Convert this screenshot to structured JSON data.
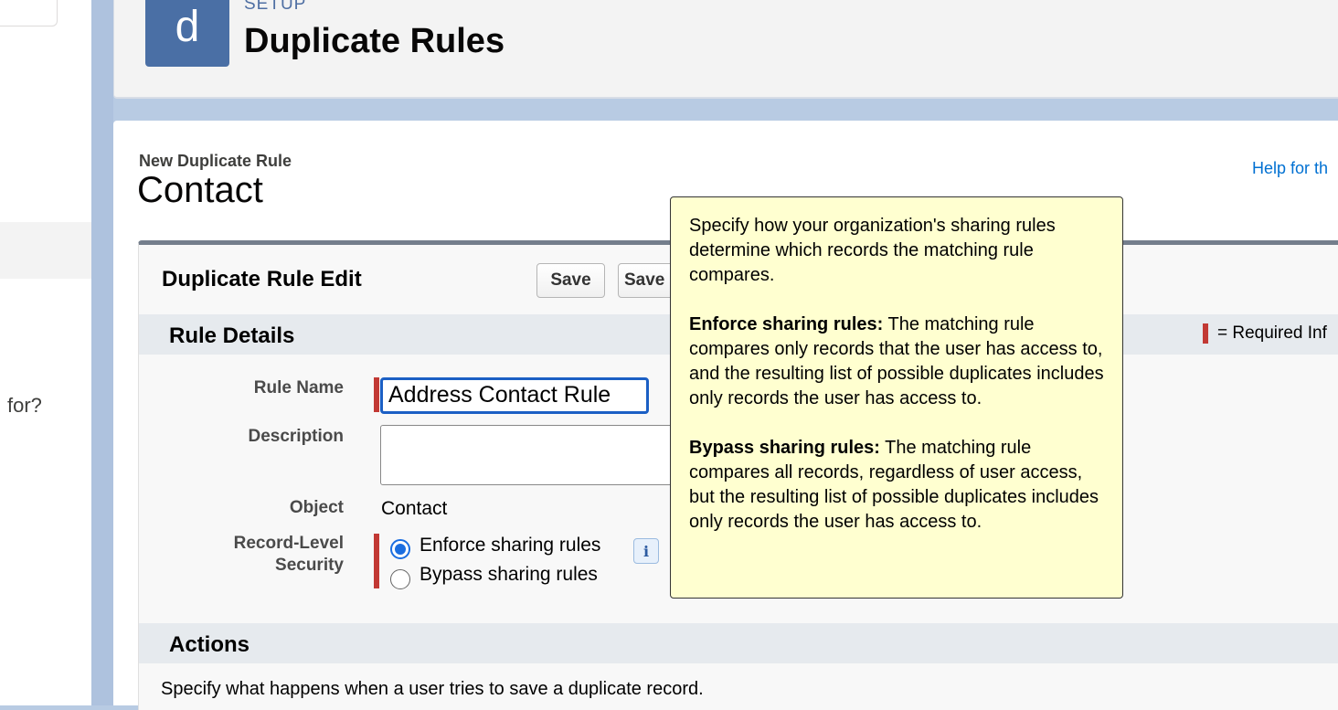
{
  "sidebar": {
    "partial_text": "for?"
  },
  "header": {
    "icon_letter": "d",
    "setup_label": "SETUP",
    "page_title": "Duplicate Rules"
  },
  "content": {
    "sub_title": "New Duplicate Rule",
    "object_title": "Contact",
    "help_link": "Help for th"
  },
  "edit": {
    "title": "Duplicate Rule Edit",
    "save_label": "Save",
    "save_new_label": "Save"
  },
  "rule_details": {
    "section_title": "Rule Details",
    "required_legend": "= Required Inf",
    "rule_name_label": "Rule Name",
    "rule_name_value": "Address Contact Rule",
    "description_label": "Description",
    "description_value": "",
    "object_label": "Object",
    "object_value": "Contact",
    "security_label_line1": "Record-Level",
    "security_label_line2": "Security",
    "options": [
      {
        "label": "Enforce sharing rules",
        "checked": true
      },
      {
        "label": "Bypass sharing rules",
        "checked": false
      }
    ],
    "info_icon": "info-icon"
  },
  "actions": {
    "section_title": "Actions",
    "description": "Specify what happens when a user tries to save a duplicate record."
  },
  "tooltip": {
    "intro": "Specify how your organization's sharing rules determine which records the matching rule compares.",
    "enforce_title": "Enforce sharing rules:",
    "enforce_text": " The matching rule compares only records that the user has access to, and the resulting list of possible duplicates includes only records the user has access to.",
    "bypass_title": "Bypass sharing rules:",
    "bypass_text": " The matching rule compares all records, regardless of user access, but the resulting list of possible duplicates includes only records the user has access to."
  },
  "colors": {
    "header_tile": "#4a6fa5",
    "required": "#c23934",
    "link": "#0070d2",
    "focus": "#1b5fc4",
    "tooltip_bg": "#ffffd0"
  }
}
